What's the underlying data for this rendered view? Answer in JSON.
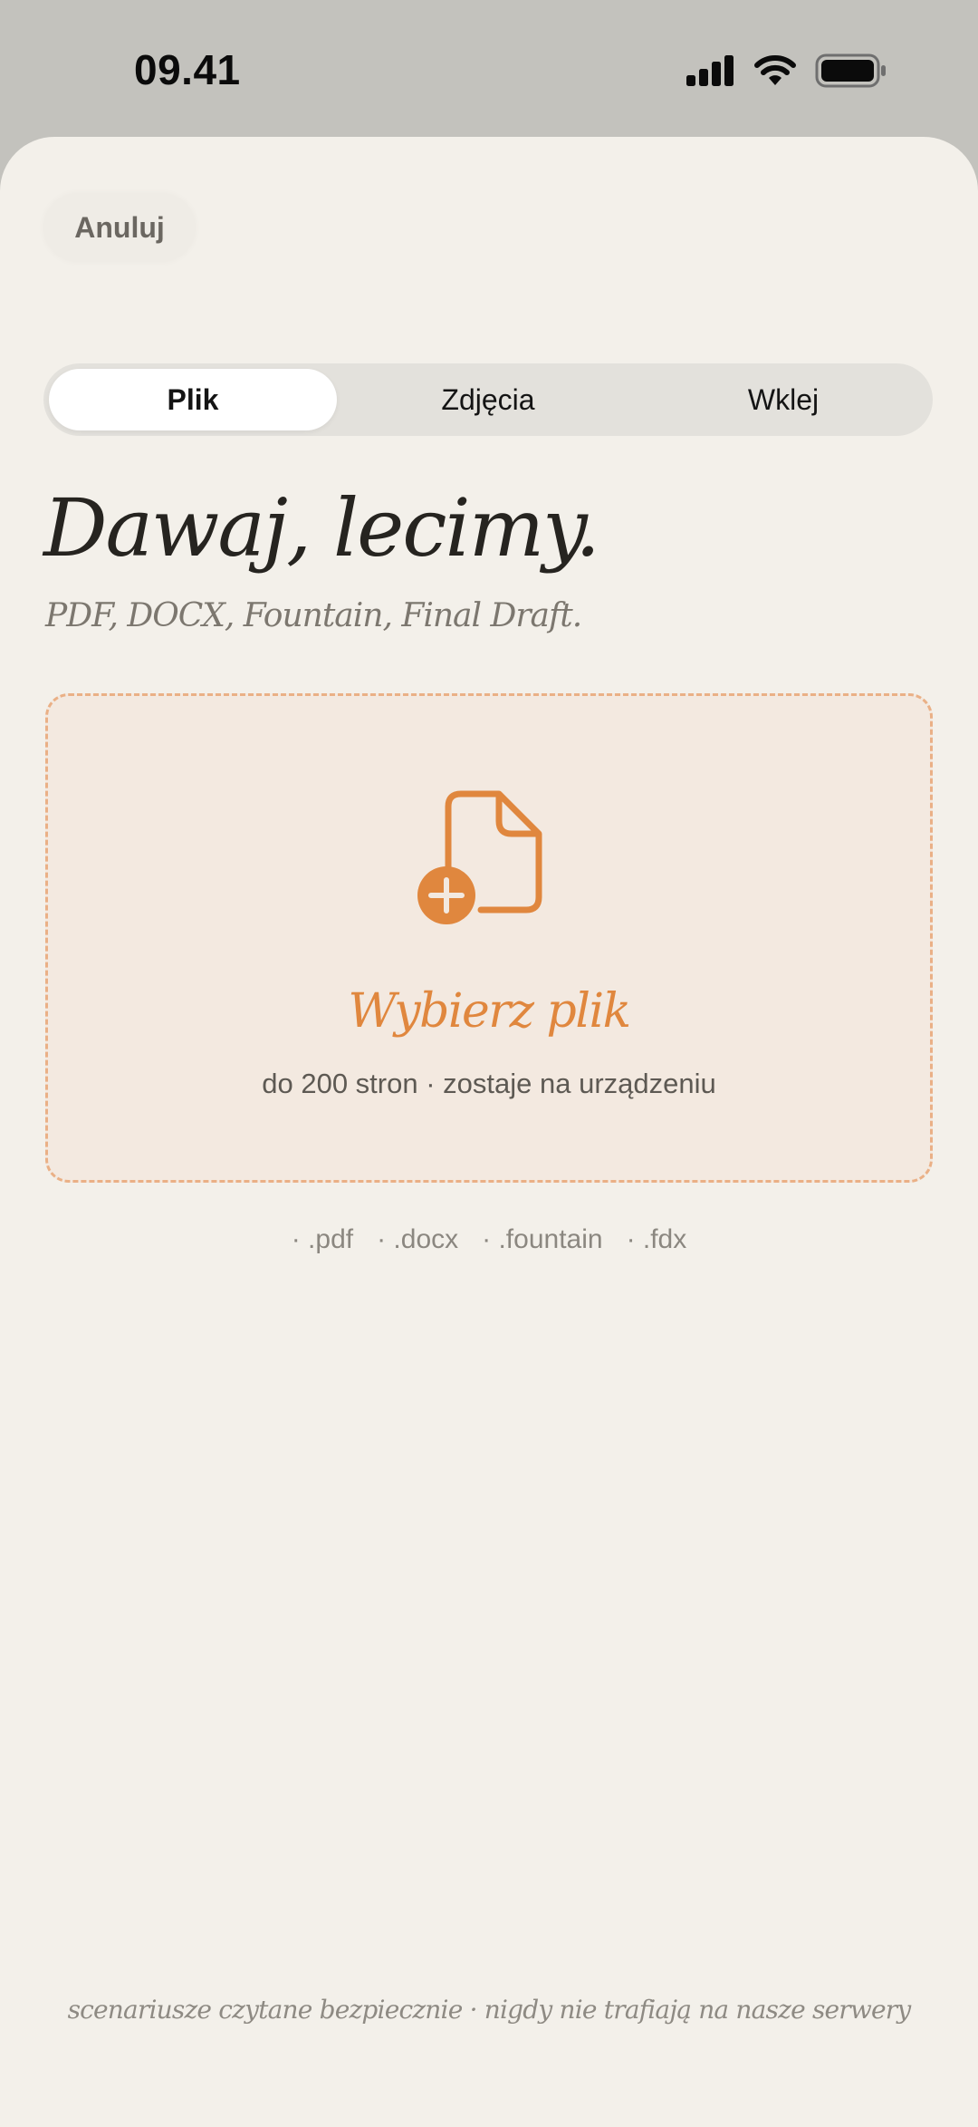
{
  "status_bar": {
    "time": "09.41",
    "icons": [
      "cellular-signal-icon",
      "wifi-icon",
      "battery-icon"
    ]
  },
  "sheet": {
    "cancel_label": "Anuluj",
    "tabs": [
      {
        "label": "Plik",
        "active": true
      },
      {
        "label": "Zdjęcia",
        "active": false
      },
      {
        "label": "Wklej",
        "active": false
      }
    ],
    "title": "Dawaj, lecimy.",
    "subtitle": "PDF, DOCX, Fountain, Final Draft.",
    "dropzone": {
      "icon": "file-add-icon",
      "label": "Wybierz plik",
      "hint": "do 200 stron · zostaje na urządzeniu"
    },
    "extensions": [
      "· .pdf",
      "· .docx",
      "· .fountain",
      "· .fdx"
    ],
    "footer": "scenariusze czytane bezpiecznie · nigdy nie trafiają na nasze serwery"
  },
  "colors": {
    "accent": "#e0873e",
    "sheet_background": "#f3f0ea",
    "dropzone_border": "#eab086",
    "dropzone_fill": "#f3e9e0",
    "top_background": "#c3c2bd"
  }
}
